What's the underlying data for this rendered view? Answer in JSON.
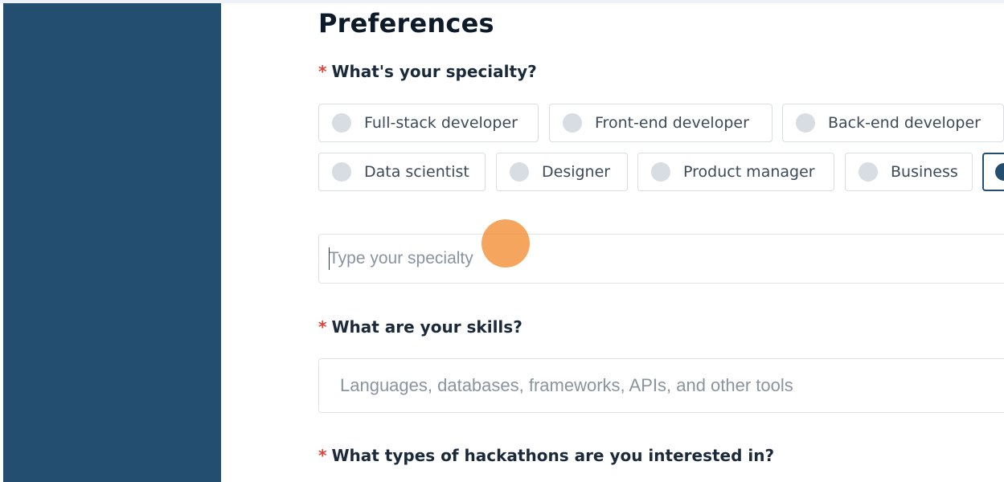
{
  "page": {
    "title": "Preferences"
  },
  "specialty": {
    "required_mark": "*",
    "question": "What's your specialty?",
    "options": [
      "Full-stack developer",
      "Front-end developer",
      "Back-end developer",
      "Data scientist",
      "Designer",
      "Product manager",
      "Business"
    ],
    "input_placeholder": "Type your specialty"
  },
  "skills": {
    "required_mark": "*",
    "question": "What are your skills?",
    "input_placeholder": "Languages, databases, frameworks, APIs, and other tools"
  },
  "hackathons": {
    "required_mark": "*",
    "question": "What types of hackathons are you interested in?"
  },
  "colors": {
    "sidebar": "#234e6f",
    "required": "#e1413a",
    "click_marker": "#f48c32"
  }
}
